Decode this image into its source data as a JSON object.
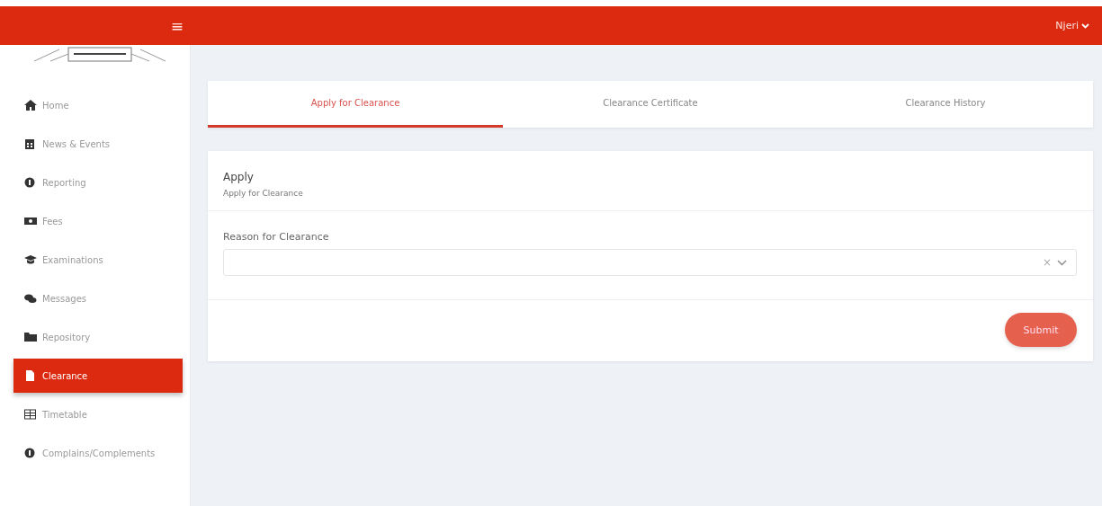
{
  "header": {
    "menu_glyph": "≡",
    "user": "Njeri"
  },
  "sidebar": {
    "items": [
      {
        "label": "Home",
        "selected": false
      },
      {
        "label": "News & Events",
        "selected": false
      },
      {
        "label": "Reporting",
        "selected": false
      },
      {
        "label": "Fees",
        "selected": false
      },
      {
        "label": "Examinations",
        "selected": false
      },
      {
        "label": "Messages",
        "selected": false
      },
      {
        "label": "Repository",
        "selected": false
      },
      {
        "label": "Clearance",
        "selected": true
      },
      {
        "label": "Timetable",
        "selected": false
      },
      {
        "label": "Complains/Complements",
        "selected": false
      }
    ]
  },
  "tabs": [
    {
      "label": "Apply for Clearance",
      "selected": true
    },
    {
      "label": "Clearance Certificate",
      "selected": false
    },
    {
      "label": "Clearance History",
      "selected": false
    }
  ],
  "card": {
    "title": "Apply",
    "subtitle": "Apply for Clearance",
    "field_label": "Reason for Clearance",
    "clear_glyph": "×",
    "submit": "Submit"
  }
}
